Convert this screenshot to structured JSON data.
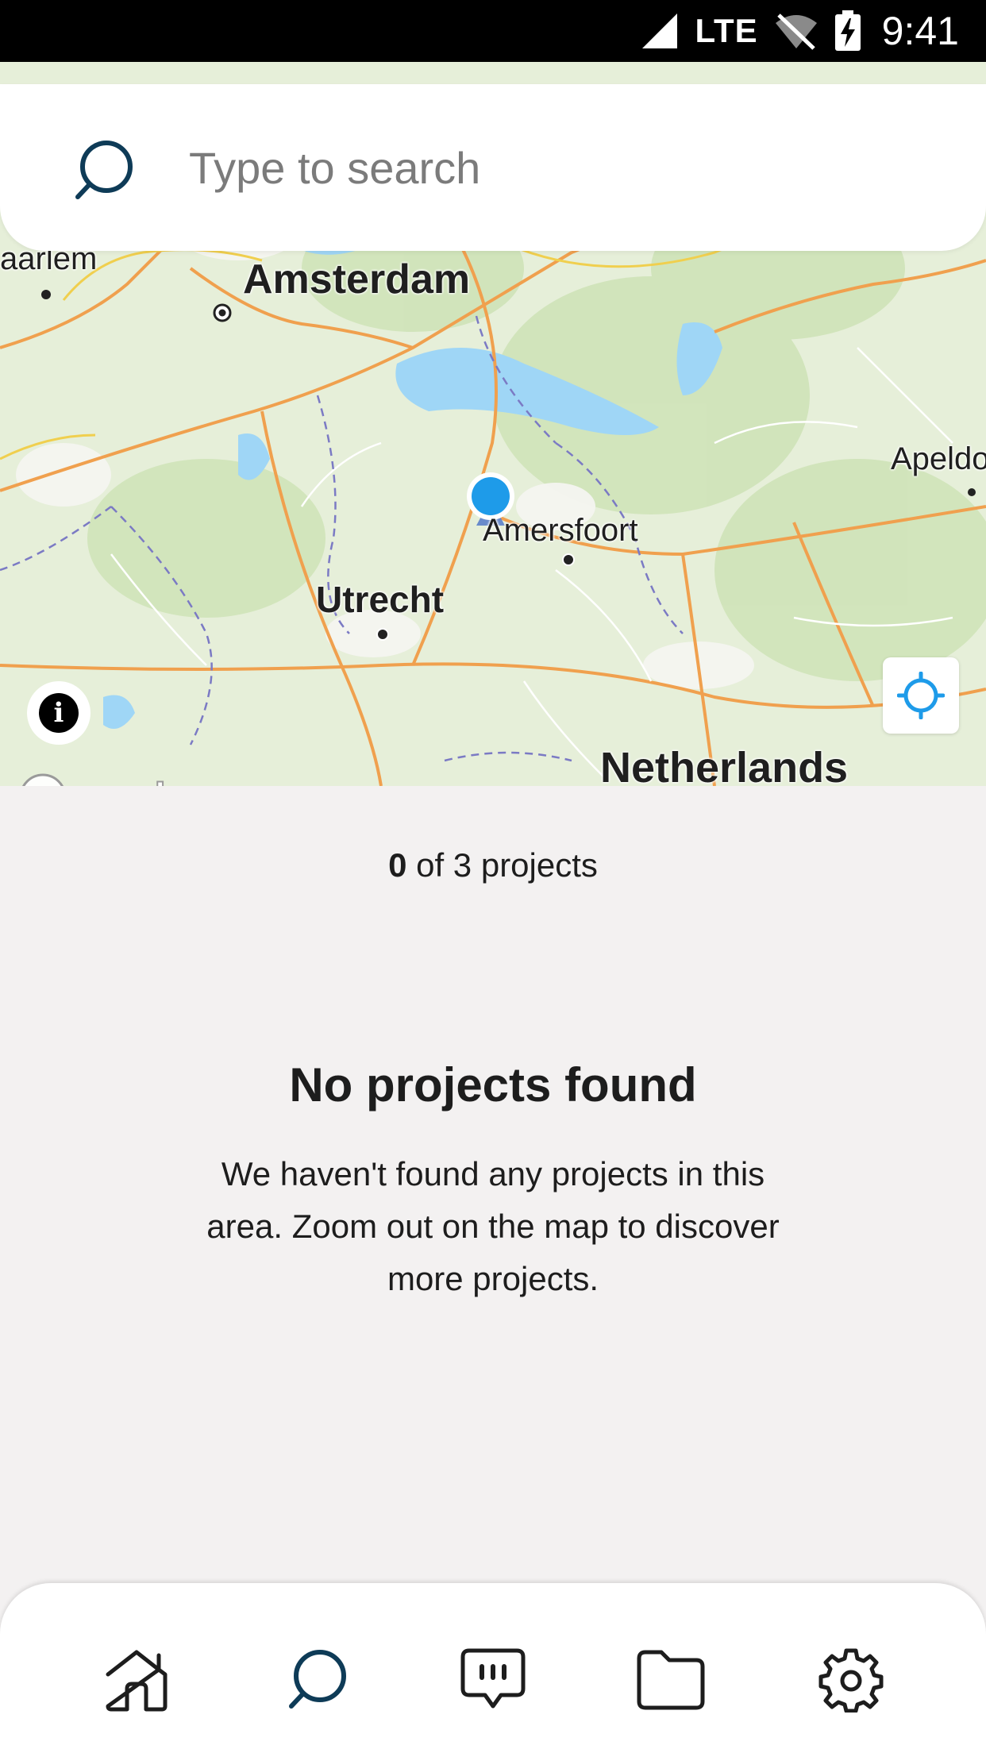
{
  "status_bar": {
    "network": "LTE",
    "time": "9:41"
  },
  "search": {
    "placeholder": "Type to search"
  },
  "map": {
    "labels": {
      "haarlem": "aarlem",
      "amsterdam": "Amsterdam",
      "apeldoorn": "Apeldo",
      "amersfoort": "Amersfoort",
      "utrecht": "Utrecht",
      "netherlands": "Netherlands"
    },
    "attribution": "mapbox",
    "user_location_color": "#1e9be9",
    "accent_color": "#1e9be9"
  },
  "results": {
    "count_shown": "0",
    "count_suffix": " of 3 projects",
    "empty_title": "No projects found",
    "empty_message": "We haven't found any projects in this area. Zoom out on the map to discover more projects."
  },
  "bottom_nav": {
    "items": [
      {
        "icon": "home-icon",
        "active": false
      },
      {
        "icon": "search-icon",
        "active": true
      },
      {
        "icon": "chat-icon",
        "active": false
      },
      {
        "icon": "folder-icon",
        "active": false
      },
      {
        "icon": "gear-icon",
        "active": false
      }
    ],
    "active_color": "#0e3b57",
    "inactive_color": "#1d1d1d"
  }
}
